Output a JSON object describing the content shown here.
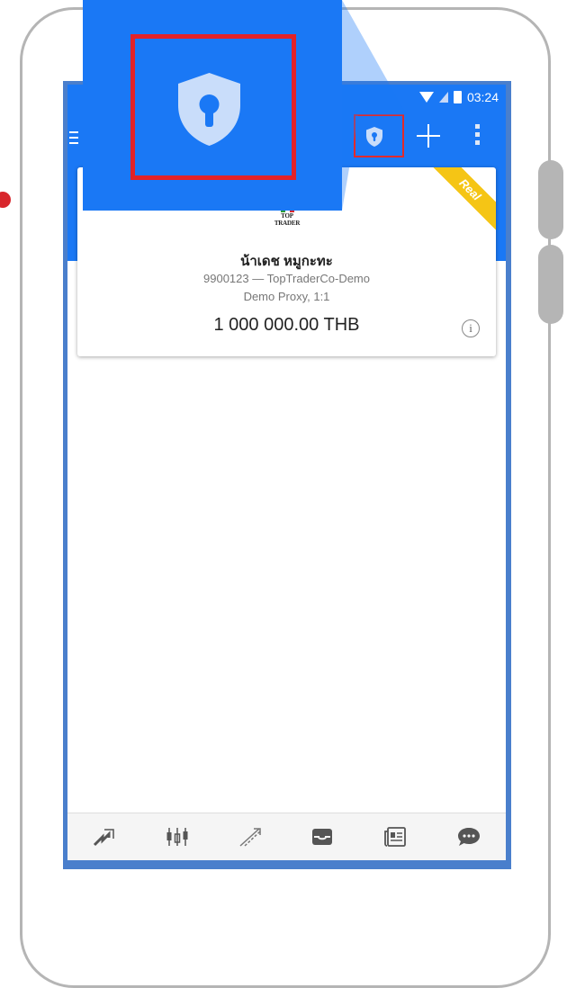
{
  "status_bar": {
    "time": "03:24"
  },
  "account_card": {
    "broker_logo_text": "TOP TRADER",
    "ribbon": "Real",
    "name": "น้าเดช หมูกะทะ",
    "account_line": "9900123 — TopTraderCo-Demo",
    "server_line": "Demo Proxy, 1:1",
    "balance": "1 000 000.00 THB"
  },
  "toolbar": {
    "icons": [
      "menu-icon",
      "shield-lock-icon",
      "plus-icon",
      "more-vert-icon"
    ]
  },
  "bottom_nav": {
    "items": [
      "quotes-icon",
      "chart-icon",
      "trade-icon",
      "history-icon",
      "news-icon",
      "chat-icon"
    ]
  },
  "colors": {
    "app_bar": "#1a78f5",
    "highlight": "#e32228",
    "ribbon": "#f5c515",
    "shield_fill": "#c9ddfa"
  }
}
